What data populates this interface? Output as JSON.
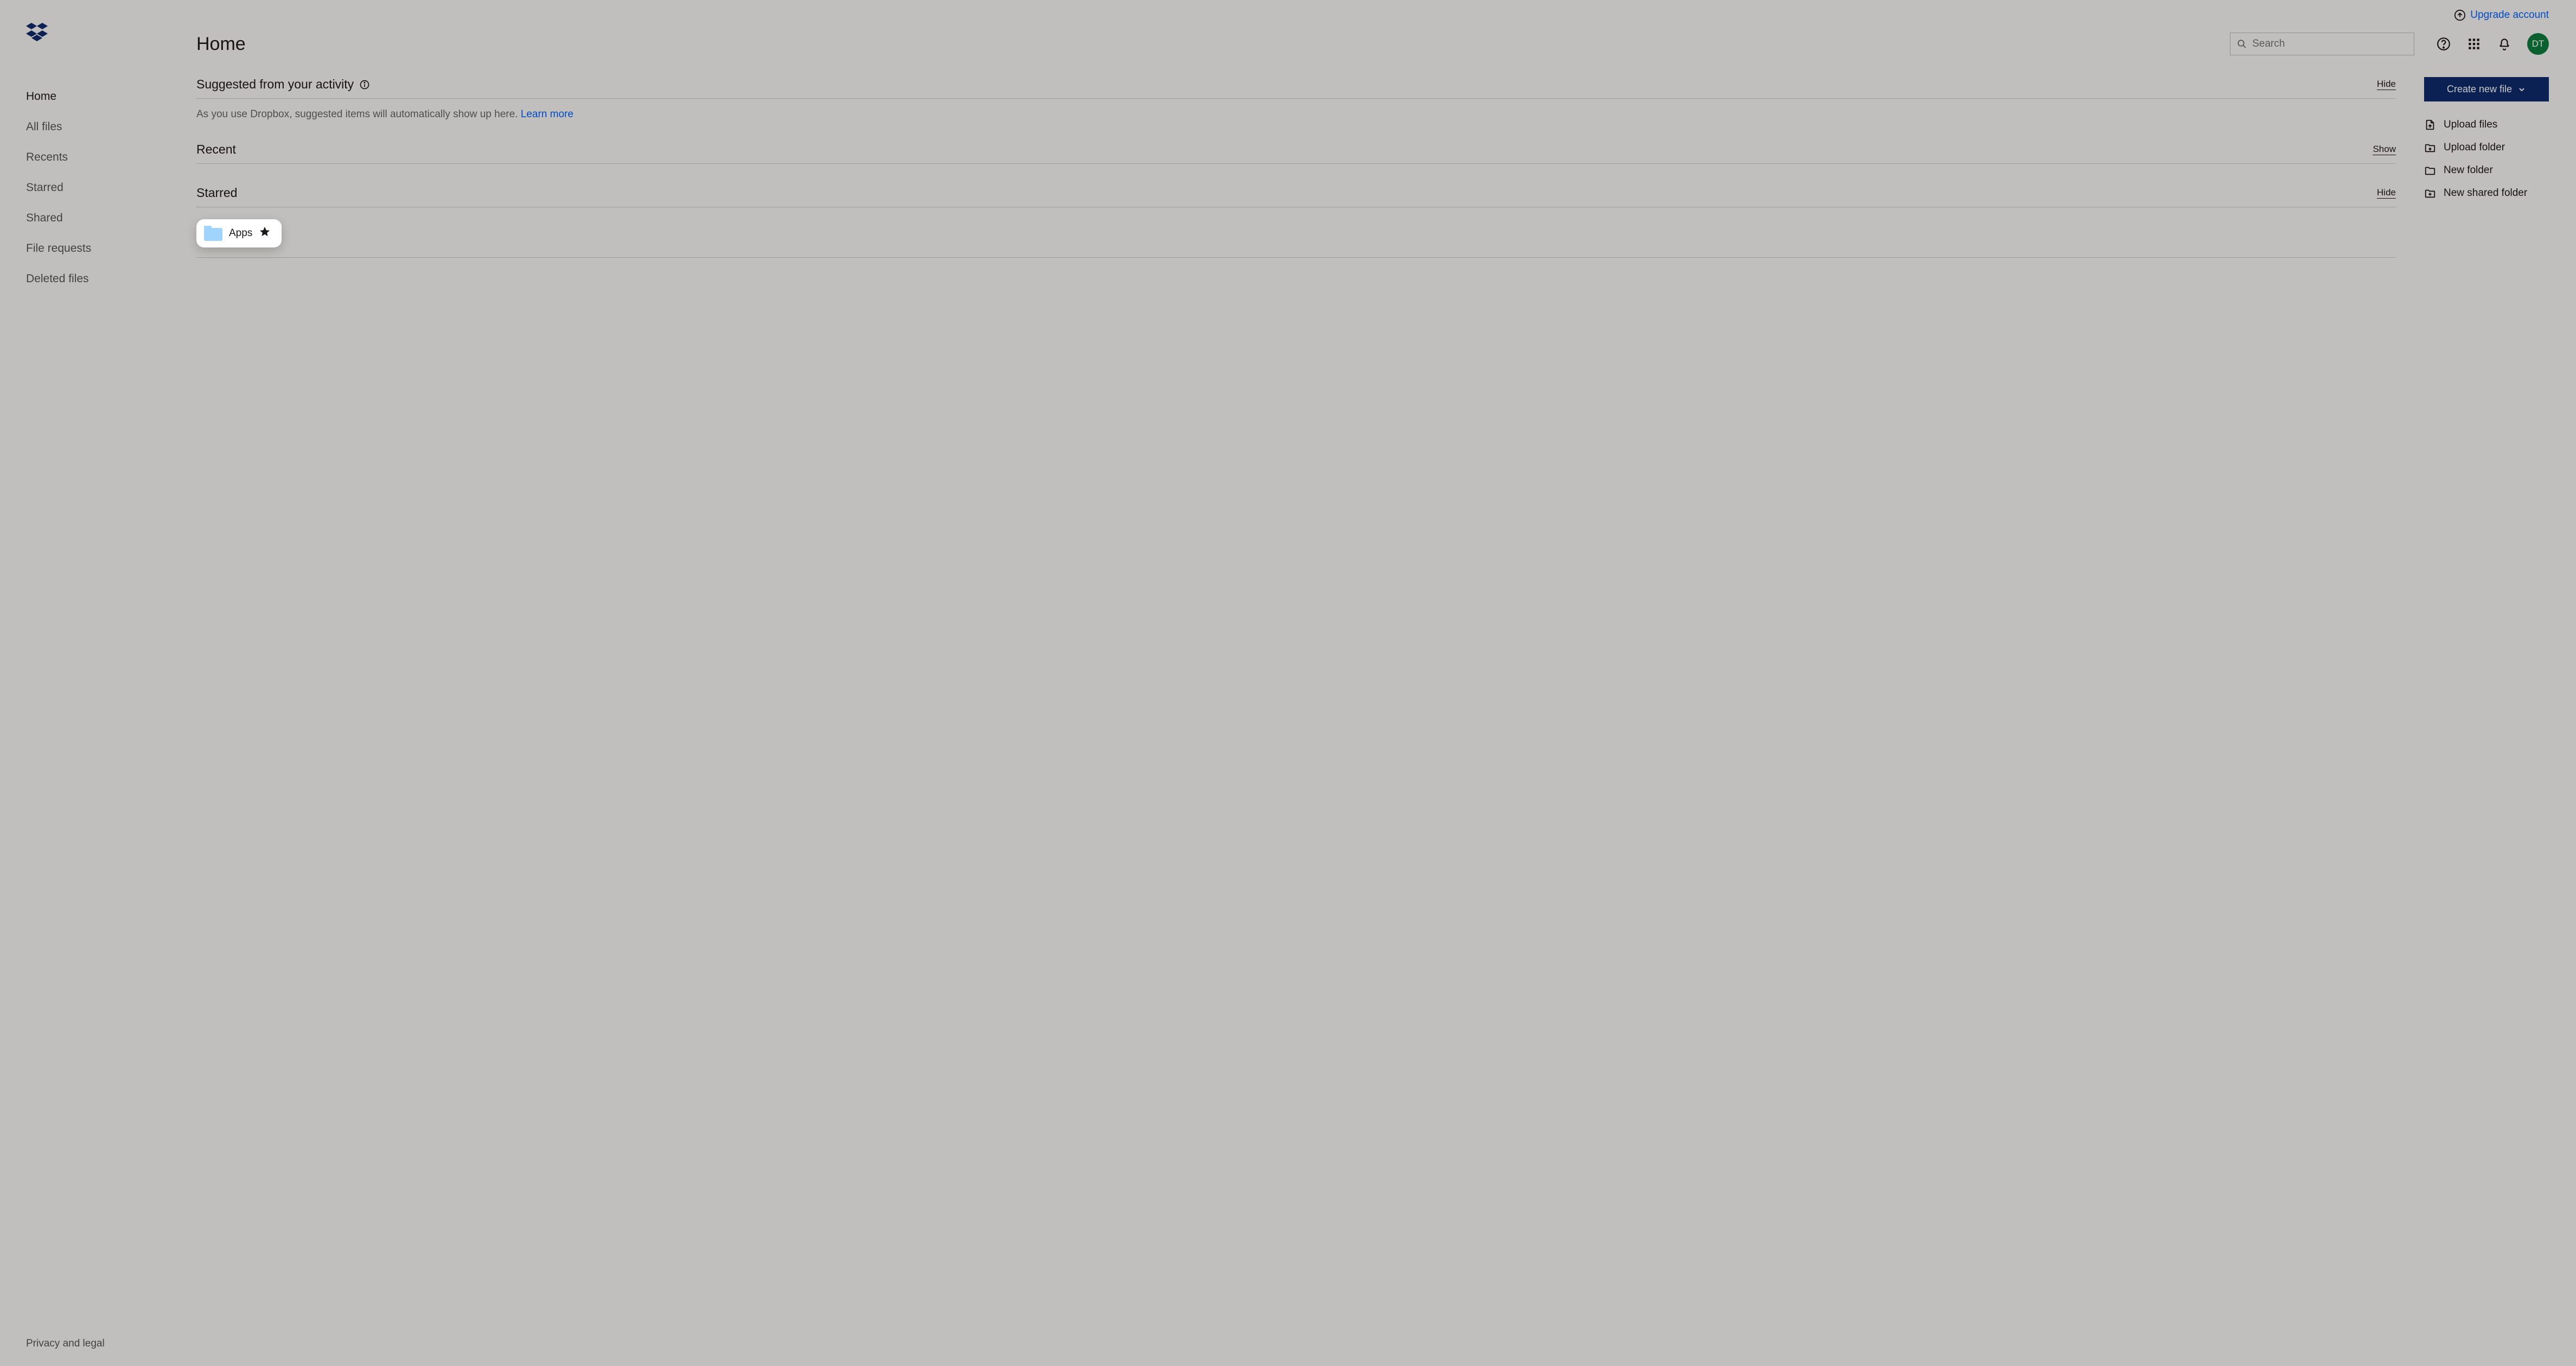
{
  "header": {
    "upgrade_link": "Upgrade account",
    "page_title": "Home",
    "search_placeholder": "Search",
    "avatar_initials": "DT"
  },
  "sidebar": {
    "items": [
      {
        "label": "Home",
        "active": true
      },
      {
        "label": "All files"
      },
      {
        "label": "Recents"
      },
      {
        "label": "Starred"
      },
      {
        "label": "Shared"
      },
      {
        "label": "File requests"
      },
      {
        "label": "Deleted files"
      }
    ],
    "footer_link": "Privacy and legal"
  },
  "sections": {
    "suggested": {
      "title": "Suggested from your activity",
      "toggle": "Hide",
      "text": "As you use Dropbox, suggested items will automatically show up here. ",
      "learn_more": "Learn more"
    },
    "recent": {
      "title": "Recent",
      "toggle": "Show"
    },
    "starred": {
      "title": "Starred",
      "toggle": "Hide",
      "items": [
        {
          "name": "Apps"
        }
      ]
    }
  },
  "actions": {
    "create_button": "Create new file",
    "list": [
      {
        "label": "Upload files",
        "icon": "upload-file-icon"
      },
      {
        "label": "Upload folder",
        "icon": "upload-folder-icon"
      },
      {
        "label": "New folder",
        "icon": "new-folder-icon"
      },
      {
        "label": "New shared folder",
        "icon": "new-shared-folder-icon"
      }
    ]
  }
}
